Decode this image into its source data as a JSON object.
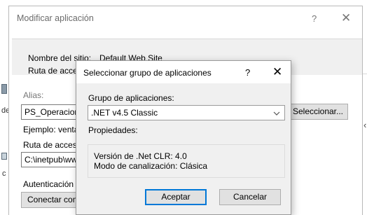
{
  "background": {
    "left_fragment_1": "de",
    "left_fragment_2": "c",
    "right_chevron": "‹"
  },
  "main_dialog": {
    "title": "Modificar aplicación",
    "help": "?",
    "close": "✕",
    "site_name_label": "Nombre del sitio:",
    "site_name_value": "Default Web Site",
    "path_label": "Ruta de acces",
    "alias_label": "Alias:",
    "alias_value": "PS_Operacione",
    "example_label": "Ejemplo: venta",
    "physical_path_label": "Ruta de acceso",
    "physical_path_value": "C:\\inetpub\\ww",
    "select_button": "Seleccionar...",
    "auth_label": "Autenticación d",
    "connect_as_button": "Conectar com"
  },
  "app_pool_dialog": {
    "title": "Seleccionar grupo de aplicaciones",
    "help": "?",
    "close": "✕",
    "pool_label": "Grupo de aplicaciones:",
    "pool_selected": ".NET v4.5 Classic",
    "properties_label": "Propiedades:",
    "clr_version": "Versión de .Net CLR: 4.0",
    "pipeline_mode": "Modo de canalización: Clásica",
    "ok_button": "Aceptar",
    "cancel_button": "Cancelar"
  },
  "colors": {
    "dialog_bg": "#f0f0f0",
    "accent": "#0078d7"
  }
}
